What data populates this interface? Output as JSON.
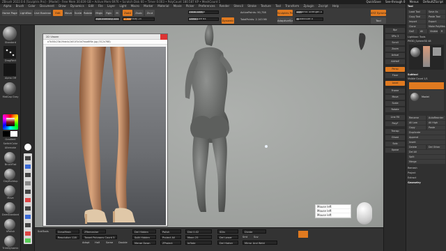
{
  "title_bar": {
    "text": "ZBrush 2022.0.6 [Sculptris Pro] - [Model] - Free Mem 30.839 GB • Active Mem 6976 • Scratch Disk 60 • Timer 0.003 • PolyCount 180.587 KP • MeshCount 1"
  },
  "menu": {
    "items": [
      "Alpha",
      "Brush",
      "Color",
      "Document",
      "Draw",
      "Dynamics",
      "Edit",
      "File",
      "Layer",
      "Light",
      "Macro",
      "Marker",
      "Material",
      "Movie",
      "Picker",
      "Preferences",
      "Render",
      "Stencil",
      "Stroke",
      "Texture",
      "Tool",
      "Transform",
      "Zplugin",
      "Zscript",
      "Help"
    ],
    "right_items": [
      "QuickSave",
      "See-through 0",
      "Menus",
      "DefaultZScript"
    ]
  },
  "toolshelf": {
    "home_page": "Home Page",
    "lightbox": "LightBox",
    "live_boolean": "Live Boolean",
    "edit": "Edit",
    "move": "Move",
    "scale": "Scale",
    "rotate": "Rotate",
    "mrgb": "Mrgb",
    "rgb": "Rgb",
    "m": "M",
    "zadd": "Zadd",
    "zsub": "Zsub",
    "zcut": "Zcut",
    "focal_shift": "Focal Shift 0",
    "draw_size": "Draw Size 64",
    "rgb_intensity": "Rgb Intensity 100",
    "z_intensity": "Z Intensity 25",
    "dynamic": "Dynamic",
    "active_points": "ActivePoints: 90,758",
    "total_points": "TotalPoints: 2.143 Mil",
    "sculptris_pro": "Sculptris Pro",
    "adaptive_size": "AdaptiveSize",
    "dynamic_strength": "Dynamic Strength 0",
    "subdiv_brush": "SubdivSize 0",
    "xyz": "XYZ Symmetry",
    "tool": "Tool",
    "spix": "SPix 3",
    "zoom": "Zoom"
  },
  "left_tray": {
    "brush_label": "Standard",
    "stroke_label": "DragRect",
    "alpha_label": "Alpha Off",
    "texture_label": "Texture Off",
    "material_label": "MatCap Gray",
    "gradient": "Gradient",
    "switch_color": "SwitchColor",
    "alternate": "Alternate",
    "brush_buttons": [
      "BrushFlat",
      "ClayBuildup",
      "Move",
      "DamStandard",
      "hPolish",
      "TrimDynamic",
      "SnakeHook",
      "Pinch"
    ]
  },
  "image_viewer": {
    "title": "2D Viewer",
    "address": "a7b58c23b19de4c2b51f3c0d7eaa6f6e.jpg (512x768)"
  },
  "bottom_bar": {
    "dynamesh": "DynaMesh",
    "resolution": "Resolution 128",
    "zremesher": "ZRemesher",
    "target_polys": "Target Polygons Count 5",
    "adapt": "Adapt",
    "half": "Half",
    "same": "Same",
    "double": "Double",
    "del_hidden": "Del Hidden",
    "split_hidden": "Split Hidden",
    "merge_down": "Merge Down",
    "polish": "Polish",
    "project_all": "Project All",
    "zproject": "ZProject",
    "subtools": "SubTools",
    "dist": "Dist 0.02",
    "mean": "Mean 25",
    "inflate": "Inflate",
    "sdiv": "SDiv",
    "del_lower": "Del Lower",
    "del_higher": "Del Higher",
    "divide": "Divide",
    "mirror_and_weld": "Mirror And Weld",
    "smt": "Smt",
    "suv": "Suv"
  },
  "mouse_popup": {
    "lines": [
      "Mouse left",
      "Mouse left",
      "Mouse left"
    ]
  },
  "right_strip": {
    "buttons": [
      "Bpr",
      "SPix 3",
      "Scroll",
      "Zoom",
      "Actual",
      "AAHalf",
      "Persp",
      "Floor",
      "Local",
      "Frame",
      "Move",
      "Scale",
      "Rotate",
      "Line Fill",
      "PolyF",
      "Transp",
      "Ghost",
      "Solo",
      "Xpose"
    ]
  },
  "right_panel": {
    "title": "Tool",
    "rows": [
      "Load Tool",
      "Save As",
      "Copy Tool",
      "Paste Tool",
      "Import",
      "Export",
      "Clone",
      "Make PolyMesh3D",
      "GoZ",
      "All",
      "Visible",
      "R",
      "Lightbox› Tools",
      "PM3D_Sphere3D 48"
    ],
    "subtool": "Subtool",
    "subtool_items": [
      "Visible Count 1/1",
      "Model"
    ],
    "sub_rows": [
      "Rename",
      "AutoReorder",
      "All Low",
      "All High",
      "Copy",
      "Paste",
      "Duplicate",
      "Append",
      "Insert",
      "Delete",
      "Del Other",
      "Del All",
      "Split",
      "Merge"
    ],
    "bottom_rows": [
      "Remesh",
      "Project",
      "Extract",
      "Geometry"
    ]
  },
  "colors": {
    "accent": "#e07a20",
    "canvas_bg": "#a6a9a6",
    "panel_bg": "#303030"
  }
}
